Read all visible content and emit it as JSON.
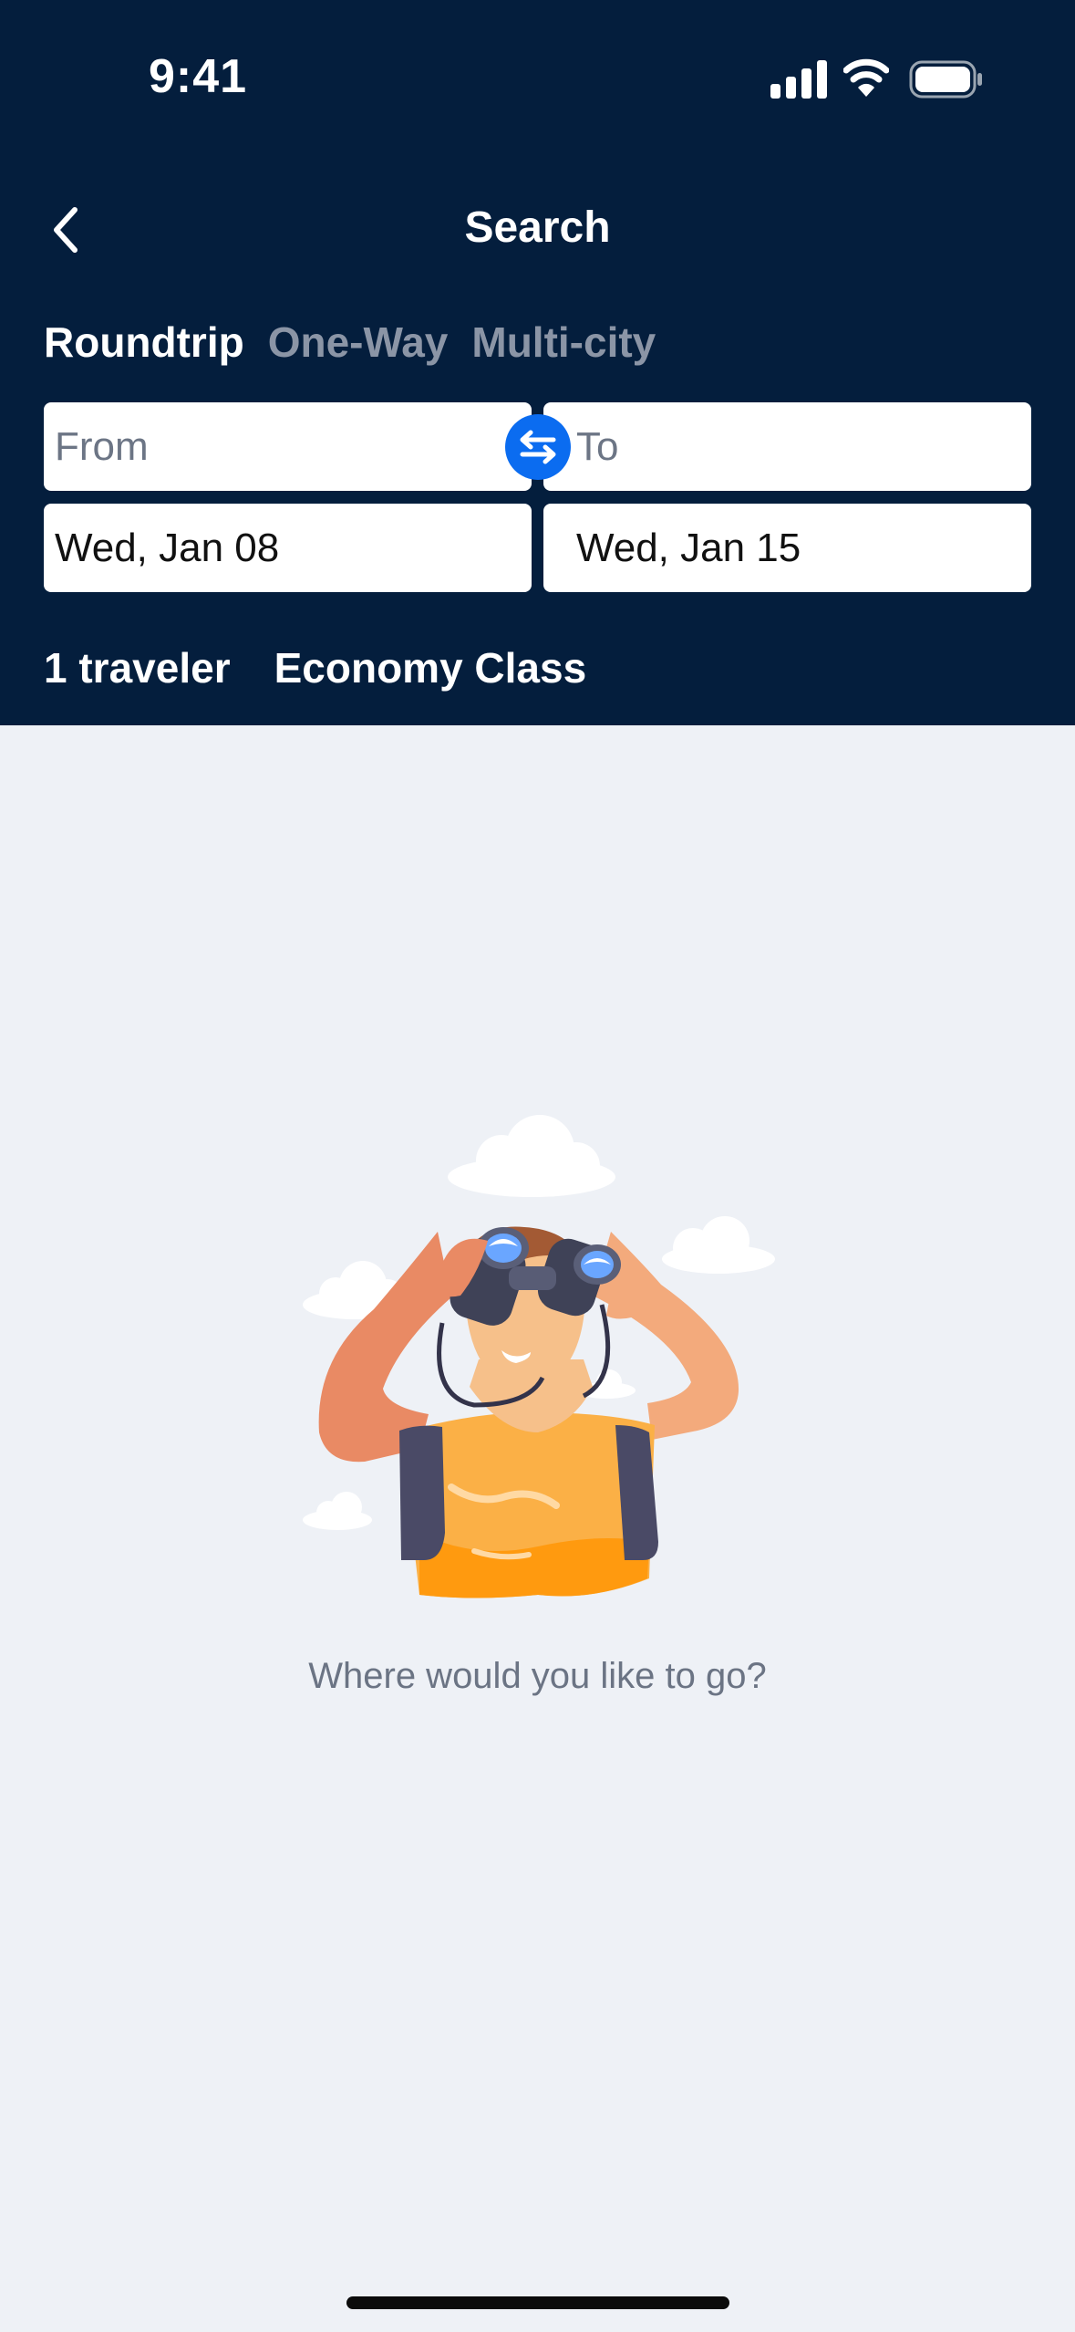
{
  "status_bar": {
    "time": "9:41"
  },
  "nav": {
    "title": "Search"
  },
  "trip_types": [
    {
      "label": "Roundtrip",
      "active": true
    },
    {
      "label": "One-Way",
      "active": false
    },
    {
      "label": "Multi-city",
      "active": false
    }
  ],
  "search": {
    "from_placeholder": "From",
    "from_value": "",
    "to_placeholder": "To",
    "to_value": "",
    "depart_date": "Wed, Jan 08",
    "return_date": "Wed, Jan 15"
  },
  "options": {
    "travelers": "1 traveler",
    "cabin_class": "Economy Class"
  },
  "empty_state": {
    "message": "Where would you like to go?"
  },
  "colors": {
    "header_bg": "#041e3d",
    "page_bg": "#eef1f6",
    "accent": "#0b6cf0",
    "shirt": "#fca62a",
    "skin": "#e98a64"
  },
  "icons": {
    "back": "chevron-left-icon",
    "swap": "swap-arrows-icon",
    "signal": "cellular-signal-icon",
    "wifi": "wifi-icon",
    "battery": "battery-icon"
  }
}
